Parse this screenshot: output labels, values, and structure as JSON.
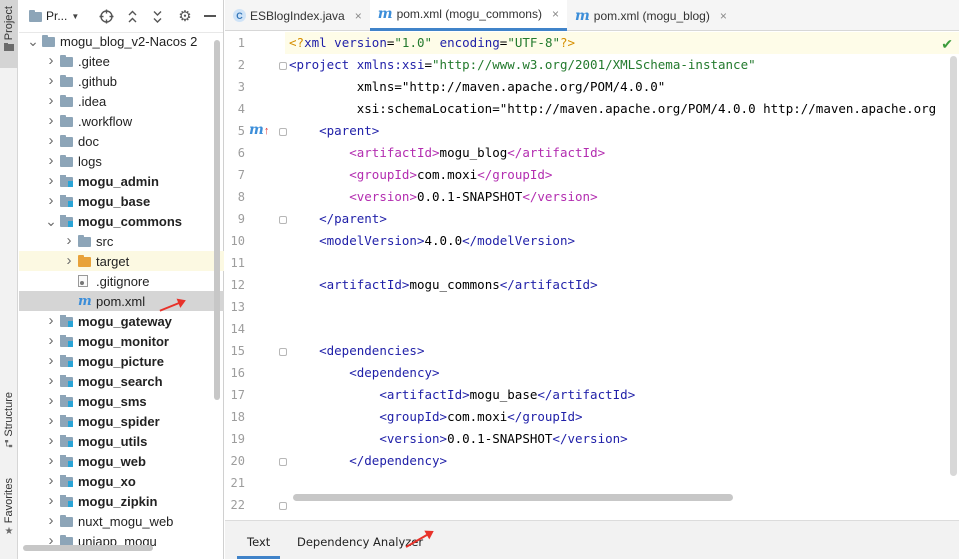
{
  "tool_strip": {
    "project_label": "Project",
    "structure_label": "Structure",
    "favorites_label": "Favorites"
  },
  "project_panel": {
    "title": "Pr...",
    "tree": [
      {
        "label": "mogu_blog_v2-Nacos 2",
        "depth": 0,
        "expanded": true,
        "icon": "folder-icon",
        "bold": false
      },
      {
        "label": ".gitee",
        "depth": 1,
        "expanded": false,
        "icon": "folder-icon",
        "bold": false
      },
      {
        "label": ".github",
        "depth": 1,
        "expanded": false,
        "icon": "folder-icon",
        "bold": false
      },
      {
        "label": ".idea",
        "depth": 1,
        "expanded": false,
        "icon": "folder-icon",
        "bold": false
      },
      {
        "label": ".workflow",
        "depth": 1,
        "expanded": false,
        "icon": "folder-icon",
        "bold": false
      },
      {
        "label": "doc",
        "depth": 1,
        "expanded": false,
        "icon": "folder-icon",
        "bold": false
      },
      {
        "label": "logs",
        "depth": 1,
        "expanded": false,
        "icon": "folder-icon",
        "bold": false
      },
      {
        "label": "mogu_admin",
        "depth": 1,
        "expanded": false,
        "icon": "module-icon",
        "bold": true
      },
      {
        "label": "mogu_base",
        "depth": 1,
        "expanded": false,
        "icon": "module-icon",
        "bold": true
      },
      {
        "label": "mogu_commons",
        "depth": 1,
        "expanded": true,
        "icon": "module-icon",
        "bold": true
      },
      {
        "label": "src",
        "depth": 2,
        "expanded": false,
        "icon": "folder-icon",
        "bold": false
      },
      {
        "label": "target",
        "depth": 2,
        "expanded": false,
        "icon": "folder-orange-icon",
        "bold": false,
        "highlight": true
      },
      {
        "label": ".gitignore",
        "depth": 2,
        "leaf": true,
        "icon": "gitignore-icon",
        "bold": false
      },
      {
        "label": "pom.xml",
        "depth": 2,
        "leaf": true,
        "icon": "maven-icon",
        "bold": false,
        "selected": true
      },
      {
        "label": "mogu_gateway",
        "depth": 1,
        "expanded": false,
        "icon": "module-icon",
        "bold": true
      },
      {
        "label": "mogu_monitor",
        "depth": 1,
        "expanded": false,
        "icon": "module-icon",
        "bold": true
      },
      {
        "label": "mogu_picture",
        "depth": 1,
        "expanded": false,
        "icon": "module-icon",
        "bold": true
      },
      {
        "label": "mogu_search",
        "depth": 1,
        "expanded": false,
        "icon": "module-icon",
        "bold": true
      },
      {
        "label": "mogu_sms",
        "depth": 1,
        "expanded": false,
        "icon": "module-icon",
        "bold": true
      },
      {
        "label": "mogu_spider",
        "depth": 1,
        "expanded": false,
        "icon": "module-icon",
        "bold": true
      },
      {
        "label": "mogu_utils",
        "depth": 1,
        "expanded": false,
        "icon": "module-icon",
        "bold": true
      },
      {
        "label": "mogu_web",
        "depth": 1,
        "expanded": false,
        "icon": "module-icon",
        "bold": true
      },
      {
        "label": "mogu_xo",
        "depth": 1,
        "expanded": false,
        "icon": "module-icon",
        "bold": true
      },
      {
        "label": "mogu_zipkin",
        "depth": 1,
        "expanded": false,
        "icon": "module-icon",
        "bold": true
      },
      {
        "label": "nuxt_mogu_web",
        "depth": 1,
        "expanded": false,
        "icon": "folder-icon",
        "bold": false
      },
      {
        "label": "uniapp_mogu",
        "depth": 1,
        "expanded": false,
        "icon": "folder-icon",
        "bold": false
      }
    ]
  },
  "editor_tabs": [
    {
      "label": "ESBlogIndex.java",
      "icon": "class-icon",
      "active": false
    },
    {
      "label": "pom.xml (mogu_commons)",
      "icon": "maven-icon",
      "active": true
    },
    {
      "label": "pom.xml (mogu_blog)",
      "icon": "maven-icon",
      "active": false
    }
  ],
  "editor": {
    "line_numbers": [
      "1",
      "2",
      "3",
      "4",
      "5",
      "6",
      "7",
      "8",
      "9",
      "10",
      "11",
      "12",
      "13",
      "14",
      "15",
      "16",
      "17",
      "18",
      "19",
      "20",
      "21",
      "22"
    ],
    "gutter_marker_line": "5",
    "code_lines": [
      "<?xml version=\"1.0\" encoding=\"UTF-8\"?>",
      "<project xmlns:xsi=\"http://www.w3.org/2001/XMLSchema-instance\"",
      "         xmlns=\"http://maven.apache.org/POM/4.0.0\"",
      "         xsi:schemaLocation=\"http://maven.apache.org/POM/4.0.0 http://maven.apache.org",
      "    <parent>",
      "        <artifactId>mogu_blog</artifactId>",
      "        <groupId>com.moxi</groupId>",
      "        <version>0.0.1-SNAPSHOT</version>",
      "    </parent>",
      "    <modelVersion>4.0.0</modelVersion>",
      "",
      "    <artifactId>mogu_commons</artifactId>",
      "",
      "",
      "    <dependencies>",
      "        <dependency>",
      "            <artifactId>mogu_base</artifactId>",
      "            <groupId>com.moxi</groupId>",
      "            <version>0.0.1-SNAPSHOT</version>",
      "        </dependency>",
      "",
      ""
    ]
  },
  "bottom_tabs": [
    {
      "label": "Text",
      "active": true
    },
    {
      "label": "Dependency Analyzer",
      "active": false
    }
  ],
  "colors": {
    "accent": "#4083c9",
    "annotation_arrow": "#e8322a"
  }
}
